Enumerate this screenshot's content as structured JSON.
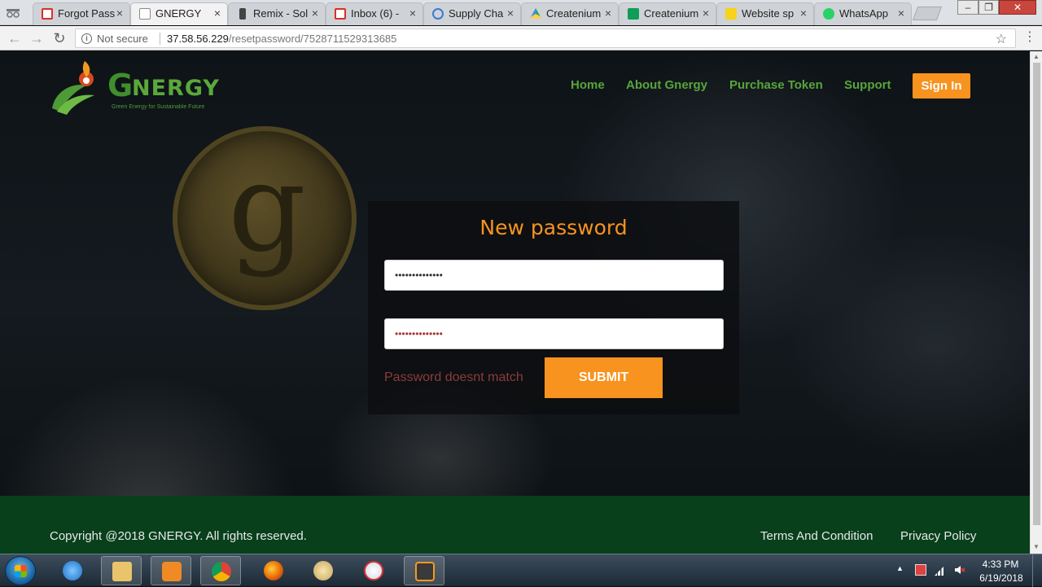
{
  "browser": {
    "tabs": [
      {
        "label": "Forgot Pass",
        "icon": "gmail-icon",
        "color": "#d93025"
      },
      {
        "label": "GNERGY",
        "icon": "page-icon",
        "color": "#888888",
        "active": true
      },
      {
        "label": "Remix - Sol",
        "icon": "remix-icon",
        "color": "#444444"
      },
      {
        "label": "Inbox (6) - ",
        "icon": "gmail-icon",
        "color": "#d93025"
      },
      {
        "label": "Supply Cha",
        "icon": "react-icon",
        "color": "#3a7bd5"
      },
      {
        "label": "Createnium",
        "icon": "drive-icon",
        "color": "#1fa463"
      },
      {
        "label": "Createnium",
        "icon": "sheets-icon",
        "color": "#0f9d58"
      },
      {
        "label": "Website sp",
        "icon": "producthunt-icon",
        "color": "#f7d417"
      },
      {
        "label": "WhatsApp",
        "icon": "whatsapp-icon",
        "color": "#25d366"
      }
    ],
    "tab_close": "×",
    "omnibox": {
      "security": "Not secure",
      "host": "37.58.56.229",
      "path": "/resetpassword/7528711529313685"
    }
  },
  "site": {
    "logo_text": "NERGY",
    "logo_g": "G",
    "logo_tagline": "Green Energy for Sustainable Future",
    "nav": [
      "Home",
      "About Gnergy",
      "Purchase Token",
      "Support"
    ],
    "signin_label": "Sign In",
    "accent": "#f7931e",
    "brand_green": "#58a53a"
  },
  "form": {
    "title": "New password",
    "password_value": "••••••••••••••",
    "confirm_value": "••••••••••••••",
    "error": "Password doesnt match",
    "submit_label": "SUBMIT"
  },
  "footer": {
    "copyright": "Copyright @2018 GNERGY. All rights reserved.",
    "links": [
      "Terms And Condition",
      "Privacy Policy"
    ]
  },
  "taskbar": {
    "time": "4:33 PM",
    "date": "6/19/2018",
    "apps": [
      "internet-explorer-icon",
      "file-explorer-icon",
      "media-player-icon",
      "chrome-icon",
      "firefox-icon",
      "paint-icon",
      "snipping-tool-icon",
      "sublime-text-icon"
    ]
  }
}
